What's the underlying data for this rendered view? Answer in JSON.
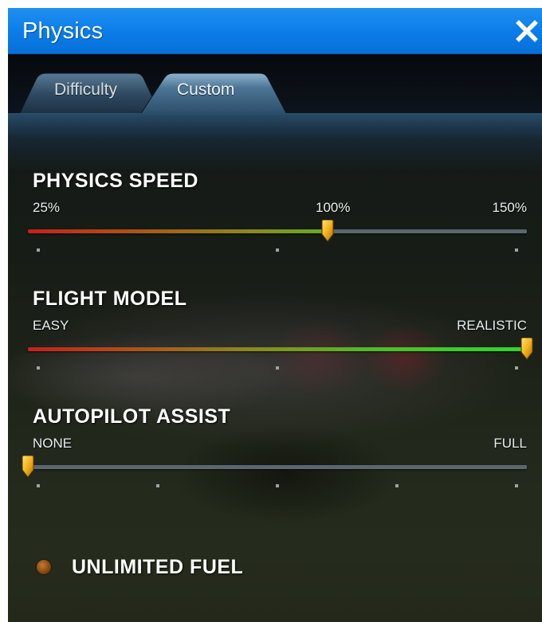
{
  "window": {
    "title": "Physics"
  },
  "tabs": [
    {
      "label": "Difficulty",
      "selected": false
    },
    {
      "label": "Custom",
      "selected": true
    }
  ],
  "sliders": [
    {
      "heading": "PHYSICS SPEED",
      "labels": {
        "left": "25%",
        "middle": "100%",
        "right": "150%"
      },
      "value_fraction": 0.6,
      "displayed_value": "100%",
      "tick_count": 3
    },
    {
      "heading": "FLIGHT MODEL",
      "labels": {
        "left": "EASY",
        "right": "REALISTIC"
      },
      "value_fraction": 1.0,
      "displayed_value": "REALISTIC",
      "tick_count": 3
    },
    {
      "heading": "AUTOPILOT ASSIST",
      "labels": {
        "left": "NONE",
        "right": "FULL"
      },
      "value_fraction": 0.0,
      "displayed_value": "NONE",
      "tick_count": 5
    }
  ],
  "options": {
    "unlimited_fuel": {
      "label": "UNLIMITED FUEL",
      "checked": false
    }
  },
  "colors": {
    "title_bar": "#0a7ce8",
    "slider_low": "#c81e1e",
    "slider_high": "#2fd62f",
    "slider_empty": "#5c6670",
    "thumb": "#f2b21b"
  },
  "icons": {
    "close": "close-icon",
    "thumb": "slider-thumb-icon",
    "radio": "radio-button-icon"
  }
}
